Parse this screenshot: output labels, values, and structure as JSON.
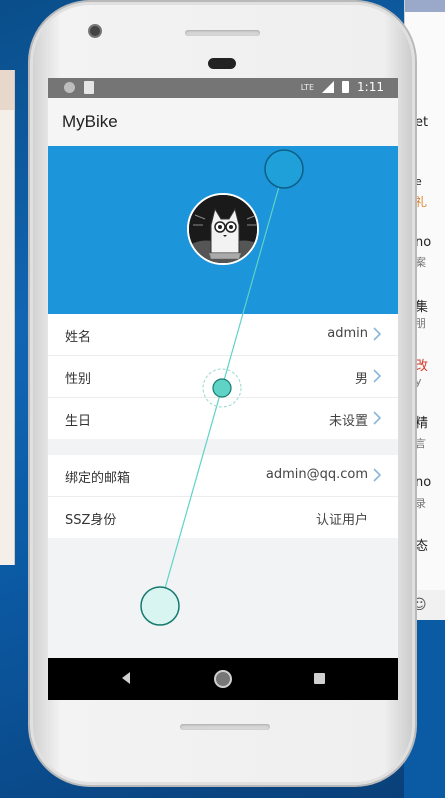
{
  "app": {
    "title": "MyBike"
  },
  "status_bar": {
    "time": "1:11",
    "network": "LTE"
  },
  "profile": {
    "rows": [
      {
        "label": "姓名",
        "value": "admin"
      },
      {
        "label": "性别",
        "value": "男"
      },
      {
        "label": "生日",
        "value": "未设置"
      }
    ],
    "account_rows": [
      {
        "label": "绑定的邮箱",
        "value": "admin@qq.com"
      },
      {
        "label": "SSZ身份",
        "value": "认证用户"
      }
    ]
  },
  "background_fragments": [
    "et",
    "e",
    "礼",
    "no",
    "案",
    "集",
    "朋",
    "改",
    "y",
    "精",
    "言",
    "no",
    "录",
    "态"
  ],
  "colors": {
    "accent": "#1c95da",
    "touch_trail": "#5fd3c6",
    "screen_bg": "#f2f3f5"
  },
  "icons": {
    "back": "back-icon",
    "home": "home-icon",
    "recents": "recents-icon",
    "chevron": "chevron-right-icon",
    "avatar": "cat-avatar"
  }
}
